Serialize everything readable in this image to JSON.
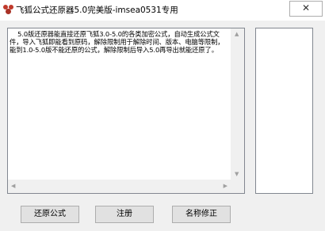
{
  "window": {
    "title": "飞狐公式还原器5.0完美版-imsea0531专用",
    "close_glyph": "✕"
  },
  "editor": {
    "text": "    5.0版还原器能直接还原飞狐3.0-5.0的各类加密公式，自动生成公式文件，导入飞狐即能看到原码，解除限制用于解除时间、版本、电脑等限制，能到1.0-5.0版不能还原的公式，解除限制后导入5.0再导出就能还原了。"
  },
  "buttons": {
    "restore": "还原公式",
    "register": "注册",
    "rename": "名称修正"
  },
  "icons": {
    "app": "fox-app-icon",
    "scroll_up": "▲",
    "scroll_down": "▼",
    "scroll_left": "◀",
    "scroll_right": "▶"
  }
}
